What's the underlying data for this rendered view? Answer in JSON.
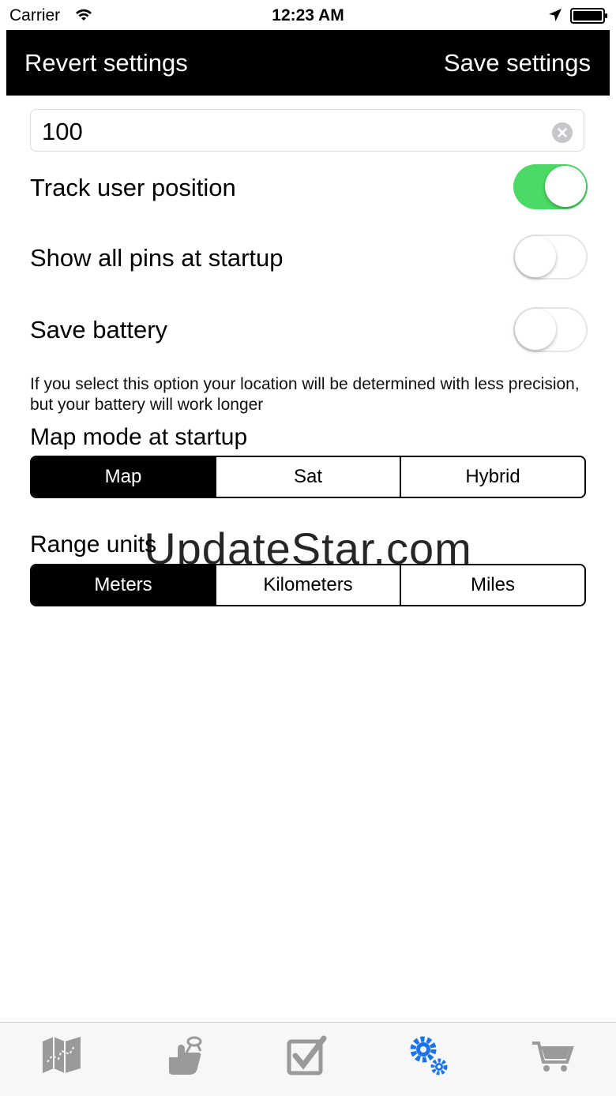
{
  "status_bar": {
    "carrier": "Carrier",
    "time": "12:23 AM"
  },
  "nav": {
    "left_label": "Revert settings",
    "right_label": "Save settings"
  },
  "range_field": {
    "value": "100"
  },
  "settings": {
    "track_user_position": {
      "label": "Track user position",
      "on": true
    },
    "show_all_pins": {
      "label": "Show all pins at startup",
      "on": false
    },
    "save_battery": {
      "label": "Save battery",
      "on": false,
      "hint": "If you select this option your location will be determined with less precision, but your battery will work longer"
    }
  },
  "map_mode": {
    "title": "Map mode at startup",
    "options": [
      "Map",
      "Sat",
      "Hybrid"
    ],
    "selected": "Map"
  },
  "range_units": {
    "title": "Range units",
    "options": [
      "Meters",
      "Kilometers",
      "Miles"
    ],
    "selected": "Meters"
  },
  "watermark": "UpdateStar.com",
  "tab_bar": {
    "tabs": [
      {
        "icon": "map-icon",
        "active": false
      },
      {
        "icon": "reminder-finger-icon",
        "active": false
      },
      {
        "icon": "checkbox-icon",
        "active": false
      },
      {
        "icon": "gears-icon",
        "active": true
      },
      {
        "icon": "cart-icon",
        "active": false
      }
    ],
    "colors": {
      "active": "#1a73e8",
      "inactive": "#8e8e8e"
    }
  },
  "colors": {
    "toggle_on": "#4cd964",
    "nav_background": "#000000"
  }
}
